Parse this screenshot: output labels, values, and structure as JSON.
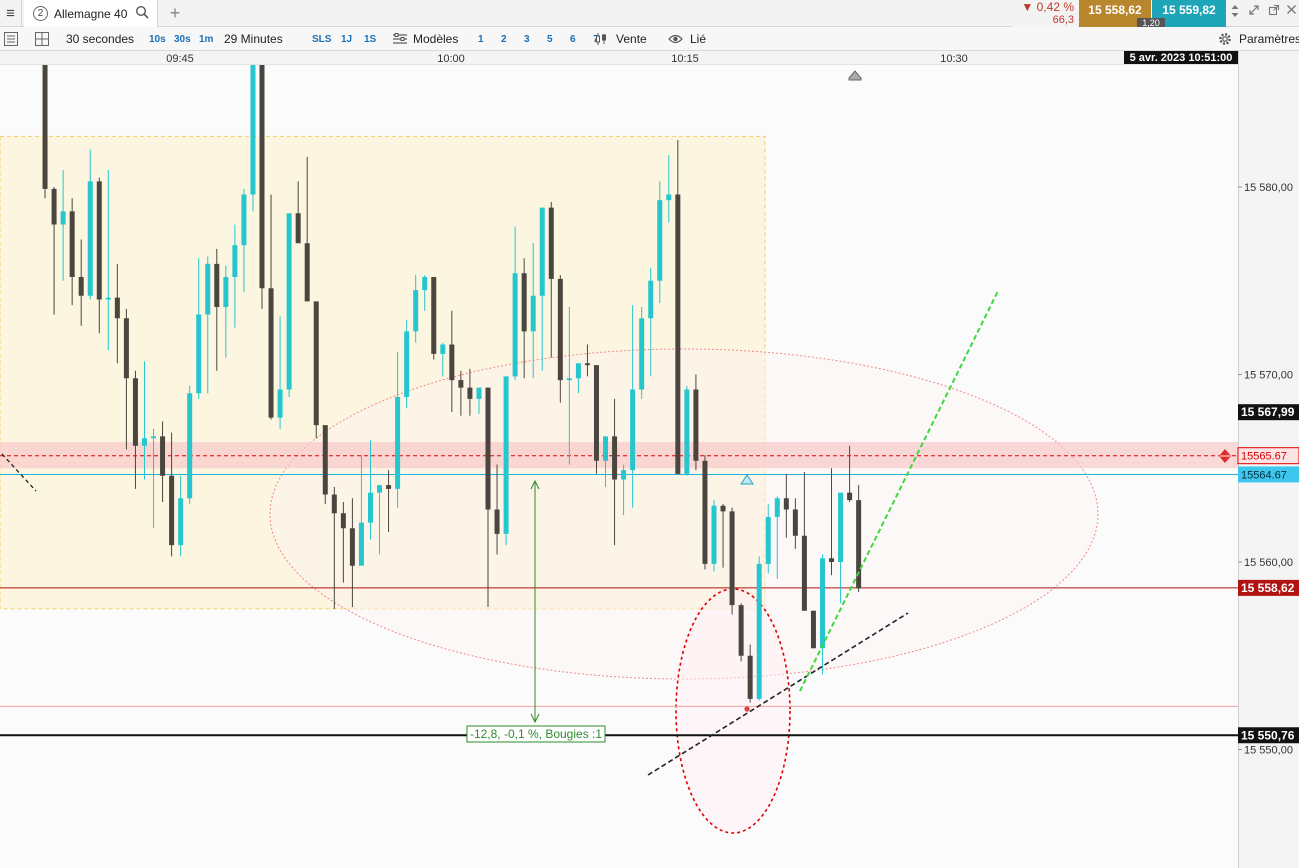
{
  "tabbar": {
    "tab_number": "2",
    "tab_title": "Allemagne 40",
    "add_tab": "+",
    "change_pct": "▼ 0,42 %",
    "change_pts": "66,3",
    "bid": "15 558,62",
    "ask": "15 559,82",
    "spread": "1,20"
  },
  "toolbar": {
    "interval": "30 secondes",
    "quick_intervals": [
      "10s",
      "30s",
      "1m"
    ],
    "duration": "29 Minutes",
    "periods": [
      "SLS",
      "1J",
      "1S"
    ],
    "models_label": "Modèles",
    "model_slots": [
      "1",
      "2",
      "3",
      "5",
      "6",
      "7"
    ],
    "sell_label": "Vente",
    "linked_label": "Lié",
    "settings_label": "Paramètres"
  },
  "chart_data": {
    "type": "candlestick",
    "x_ticks": [
      "09:45",
      "10:00",
      "10:15",
      "10:30"
    ],
    "timestamp": "5 avr. 2023 10:51:00",
    "y_ticks": [
      15550,
      15560,
      15570,
      15580
    ],
    "y_tick_labels": [
      "15 550,00",
      "15 560,00",
      "15 570,00",
      "15 580,00"
    ],
    "ylim": [
      15542,
      15590
    ],
    "bull_color": "#26c6cf",
    "bear_color": "#4a463f",
    "candles": [
      [
        15590.0,
        15592.0,
        15587.6,
        15588.0
      ],
      [
        15588.0,
        15590.1,
        15579.4,
        15579.9
      ],
      [
        15579.9,
        15580.0,
        15573.2,
        15578.0
      ],
      [
        15578.0,
        15580.9,
        15575.0,
        15578.7
      ],
      [
        15578.7,
        15579.4,
        15573.7,
        15575.2
      ],
      [
        15575.2,
        15577.2,
        15572.6,
        15574.2
      ],
      [
        15574.2,
        15582.0,
        15574.0,
        15580.3
      ],
      [
        15580.3,
        15580.5,
        15572.2,
        15574.0
      ],
      [
        15574.0,
        15580.9,
        15571.3,
        15574.1
      ],
      [
        15574.1,
        15575.9,
        15570.6,
        15573.0
      ],
      [
        15573.0,
        15573.5,
        15566.0,
        15569.8
      ],
      [
        15569.8,
        15570.2,
        15563.9,
        15566.2
      ],
      [
        15566.2,
        15570.7,
        15564.4,
        15566.6
      ],
      [
        15566.6,
        15567.1,
        15561.8,
        15566.7
      ],
      [
        15566.7,
        15567.5,
        15563.2,
        15564.6
      ],
      [
        15564.6,
        15566.9,
        15560.3,
        15560.9
      ],
      [
        15560.9,
        15564.6,
        15560.3,
        15563.4
      ],
      [
        15563.4,
        15569.4,
        15563.1,
        15569.0
      ],
      [
        15569.0,
        15576.2,
        15568.7,
        15573.2
      ],
      [
        15573.2,
        15576.3,
        15569.0,
        15575.9
      ],
      [
        15575.9,
        15576.7,
        15570.2,
        15573.6
      ],
      [
        15573.6,
        15575.8,
        15570.9,
        15575.2
      ],
      [
        15575.2,
        15578.0,
        15572.5,
        15576.9
      ],
      [
        15576.9,
        15579.9,
        15574.4,
        15579.6
      ],
      [
        15579.6,
        15590.0,
        15578.7,
        15586.8
      ],
      [
        15586.8,
        15590.0,
        15573.5,
        15574.6
      ],
      [
        15574.6,
        15579.6,
        15567.6,
        15567.7
      ],
      [
        15567.7,
        15573.1,
        15567.1,
        15569.2
      ],
      [
        15569.2,
        15576.7,
        15568.8,
        15578.6
      ],
      [
        15578.6,
        15580.3,
        15577.1,
        15577.0
      ],
      [
        15577.0,
        15581.6,
        15574.8,
        15573.9
      ],
      [
        15573.9,
        15573.7,
        15566.6,
        15567.3
      ],
      [
        15567.3,
        15567.1,
        15563.1,
        15563.6
      ],
      [
        15563.6,
        15564.0,
        15557.5,
        15562.6
      ],
      [
        15562.6,
        15563.2,
        15558.9,
        15561.8
      ],
      [
        15561.8,
        15563.4,
        15557.6,
        15559.8
      ],
      [
        15559.8,
        15565.7,
        15560.0,
        15562.1
      ],
      [
        15562.1,
        15566.5,
        15561.2,
        15563.7
      ],
      [
        15563.7,
        15563.9,
        15560.4,
        15564.1
      ],
      [
        15564.1,
        15564.9,
        15561.6,
        15563.9
      ],
      [
        15563.9,
        15571.2,
        15562.9,
        15568.8
      ],
      [
        15568.8,
        15572.9,
        15568.2,
        15572.3
      ],
      [
        15572.3,
        15575.3,
        15571.7,
        15574.5
      ],
      [
        15574.5,
        15575.3,
        15573.4,
        15575.2
      ],
      [
        15575.2,
        15574.9,
        15570.8,
        15571.1
      ],
      [
        15571.1,
        15571.7,
        15569.9,
        15571.6
      ],
      [
        15571.6,
        15573.4,
        15568.0,
        15569.7
      ],
      [
        15569.7,
        15570.2,
        15567.8,
        15569.3
      ],
      [
        15569.3,
        15570.3,
        15567.8,
        15568.7
      ],
      [
        15568.7,
        15569.0,
        15567.9,
        15569.3
      ],
      [
        15569.3,
        15569.1,
        15557.6,
        15562.8
      ],
      [
        15562.8,
        15565.2,
        15560.4,
        15561.5
      ],
      [
        15561.5,
        15569.9,
        15560.9,
        15569.9
      ],
      [
        15569.9,
        15577.9,
        15569.7,
        15575.4
      ],
      [
        15575.4,
        15576.2,
        15569.8,
        15572.3
      ],
      [
        15572.3,
        15577.0,
        15569.8,
        15574.2
      ],
      [
        15574.2,
        15576.5,
        15570.2,
        15578.9
      ],
      [
        15578.9,
        15579.2,
        15570.9,
        15575.1
      ],
      [
        15575.1,
        15575.3,
        15568.5,
        15569.7
      ],
      [
        15569.7,
        15573.6,
        15565.2,
        15569.8
      ],
      [
        15569.8,
        15570.3,
        15569.0,
        15570.6
      ],
      [
        15570.6,
        15571.6,
        15569.9,
        15570.5
      ],
      [
        15570.5,
        15570.4,
        15564.7,
        15565.4
      ],
      [
        15565.4,
        15566.7,
        15564.0,
        15566.7
      ],
      [
        15566.7,
        15568.7,
        15560.9,
        15564.4
      ],
      [
        15564.4,
        15565.2,
        15562.5,
        15564.9
      ],
      [
        15564.9,
        15573.7,
        15562.9,
        15569.2
      ],
      [
        15569.2,
        15573.6,
        15568.7,
        15573.0
      ],
      [
        15573.0,
        15575.7,
        15569.9,
        15575.0
      ],
      [
        15575.0,
        15580.3,
        15573.8,
        15579.3
      ],
      [
        15579.3,
        15581.7,
        15578.1,
        15579.6
      ],
      [
        15579.6,
        15582.5,
        15564.7,
        15564.7
      ],
      [
        15564.7,
        15569.4,
        15564.6,
        15569.2
      ],
      [
        15569.2,
        15570.0,
        15564.9,
        15565.4
      ],
      [
        15565.4,
        15565.7,
        15559.6,
        15559.9
      ],
      [
        15559.9,
        15563.3,
        15559.5,
        15563.0
      ],
      [
        15563.0,
        15563.1,
        15559.7,
        15562.7
      ],
      [
        15562.7,
        15562.9,
        15557.2,
        15557.7
      ],
      [
        15557.7,
        15557.8,
        15554.7,
        15555.0
      ],
      [
        15555.0,
        15555.6,
        15552.5,
        15552.7
      ],
      [
        15552.7,
        15560.3,
        15552.6,
        15559.9
      ],
      [
        15559.9,
        15563.1,
        15559.4,
        15562.4
      ],
      [
        15562.4,
        15563.5,
        15559.1,
        15563.4
      ],
      [
        15563.4,
        15564.7,
        15561.3,
        15562.8
      ],
      [
        15562.8,
        15563.4,
        15560.7,
        15561.4
      ],
      [
        15561.4,
        15564.8,
        15557.4,
        15557.4
      ],
      [
        15557.4,
        15557.4,
        15555.4,
        15555.4
      ],
      [
        15555.4,
        15560.4,
        15554.0,
        15560.2
      ],
      [
        15560.2,
        15565.0,
        15559.3,
        15560.0
      ],
      [
        15560.0,
        15563.6,
        15557.8,
        15563.7
      ],
      [
        15563.7,
        15566.2,
        15563.2,
        15563.3
      ],
      [
        15563.3,
        15564.1,
        15558.4,
        15558.6
      ]
    ],
    "price_lines": [
      {
        "label": "15 567,99",
        "value": 15567.99,
        "color": "#111111"
      },
      {
        "label": "15565.67",
        "value": 15565.67,
        "color": "#e00000"
      },
      {
        "label": "15564.67",
        "value": 15564.67,
        "color": "#1fb3d9"
      },
      {
        "label": "15 558,62",
        "value": 15558.62,
        "color": "#b11212"
      },
      {
        "label": "15 550,76",
        "value": 15550.76,
        "color": "#111111"
      }
    ],
    "annotation_label": "-12,8, -0,1 %, Bougies :1"
  }
}
